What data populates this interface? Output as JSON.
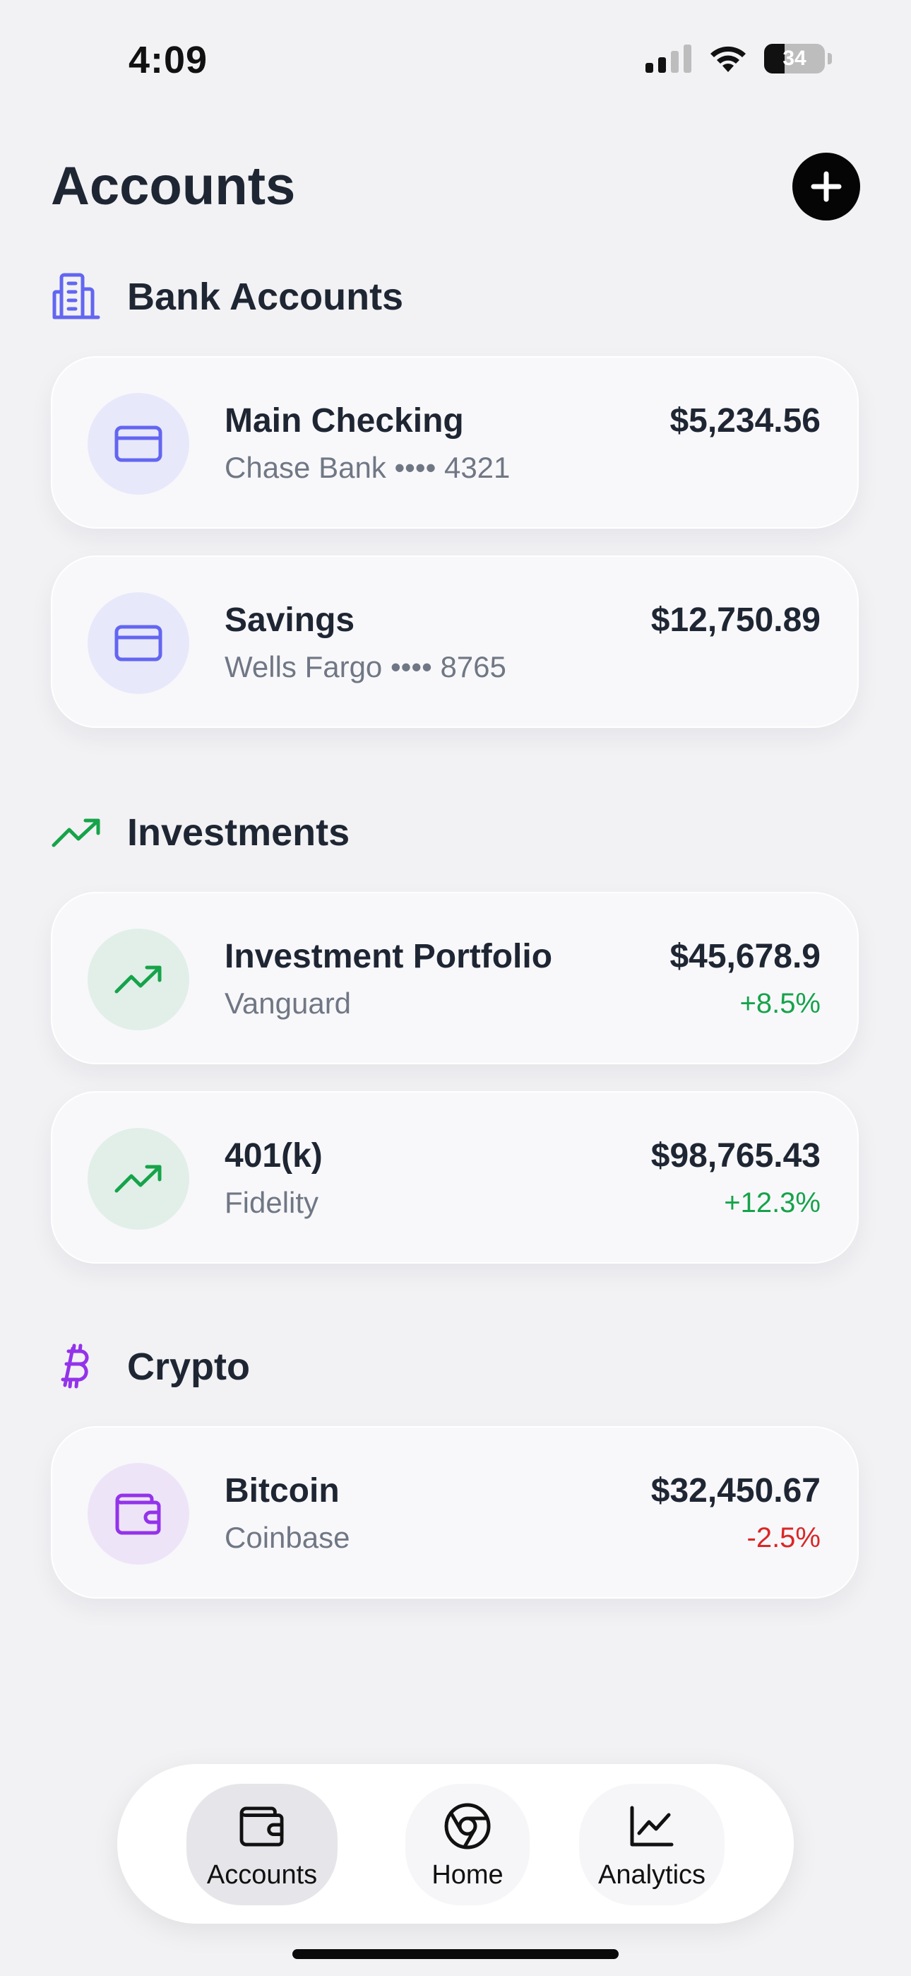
{
  "status_bar": {
    "time": "4:09",
    "battery_percent": "34"
  },
  "header": {
    "title": "Accounts"
  },
  "sections": [
    {
      "title": "Bank Accounts",
      "icon": "building-icon",
      "accounts": [
        {
          "name": "Main Checking",
          "subtitle": "Chase Bank •••• 4321",
          "amount": "$5,234.56",
          "icon": "credit-card-icon"
        },
        {
          "name": "Savings",
          "subtitle": "Wells Fargo •••• 8765",
          "amount": "$12,750.89",
          "icon": "credit-card-icon"
        }
      ]
    },
    {
      "title": "Investments",
      "icon": "trending-up-icon",
      "accounts": [
        {
          "name": "Investment Portfolio",
          "subtitle": "Vanguard",
          "amount": "$45,678.9",
          "change": "+8.5%",
          "icon": "trending-up-icon"
        },
        {
          "name": "401(k)",
          "subtitle": "Fidelity",
          "amount": "$98,765.43",
          "change": "+12.3%",
          "icon": "trending-up-icon"
        }
      ]
    },
    {
      "title": "Crypto",
      "icon": "bitcoin-icon",
      "accounts": [
        {
          "name": "Bitcoin",
          "subtitle": "Coinbase",
          "amount": "$32,450.67",
          "change": "-2.5%",
          "icon": "wallet-icon"
        }
      ]
    }
  ],
  "tab_bar": [
    {
      "label": "Accounts",
      "icon": "wallet-icon",
      "active": true
    },
    {
      "label": "Home",
      "icon": "chrome-icon",
      "active": false
    },
    {
      "label": "Analytics",
      "icon": "line-chart-icon",
      "active": false
    }
  ],
  "colors": {
    "bank_accent": "#6366f1",
    "bank_bg": "#e8e8fb",
    "investment_accent": "#16a34a",
    "investment_bg": "#e1efe8",
    "crypto_accent": "#9333ea",
    "crypto_bg": "#eee4f8",
    "positive": "#16a34a",
    "negative": "#dc2626"
  }
}
